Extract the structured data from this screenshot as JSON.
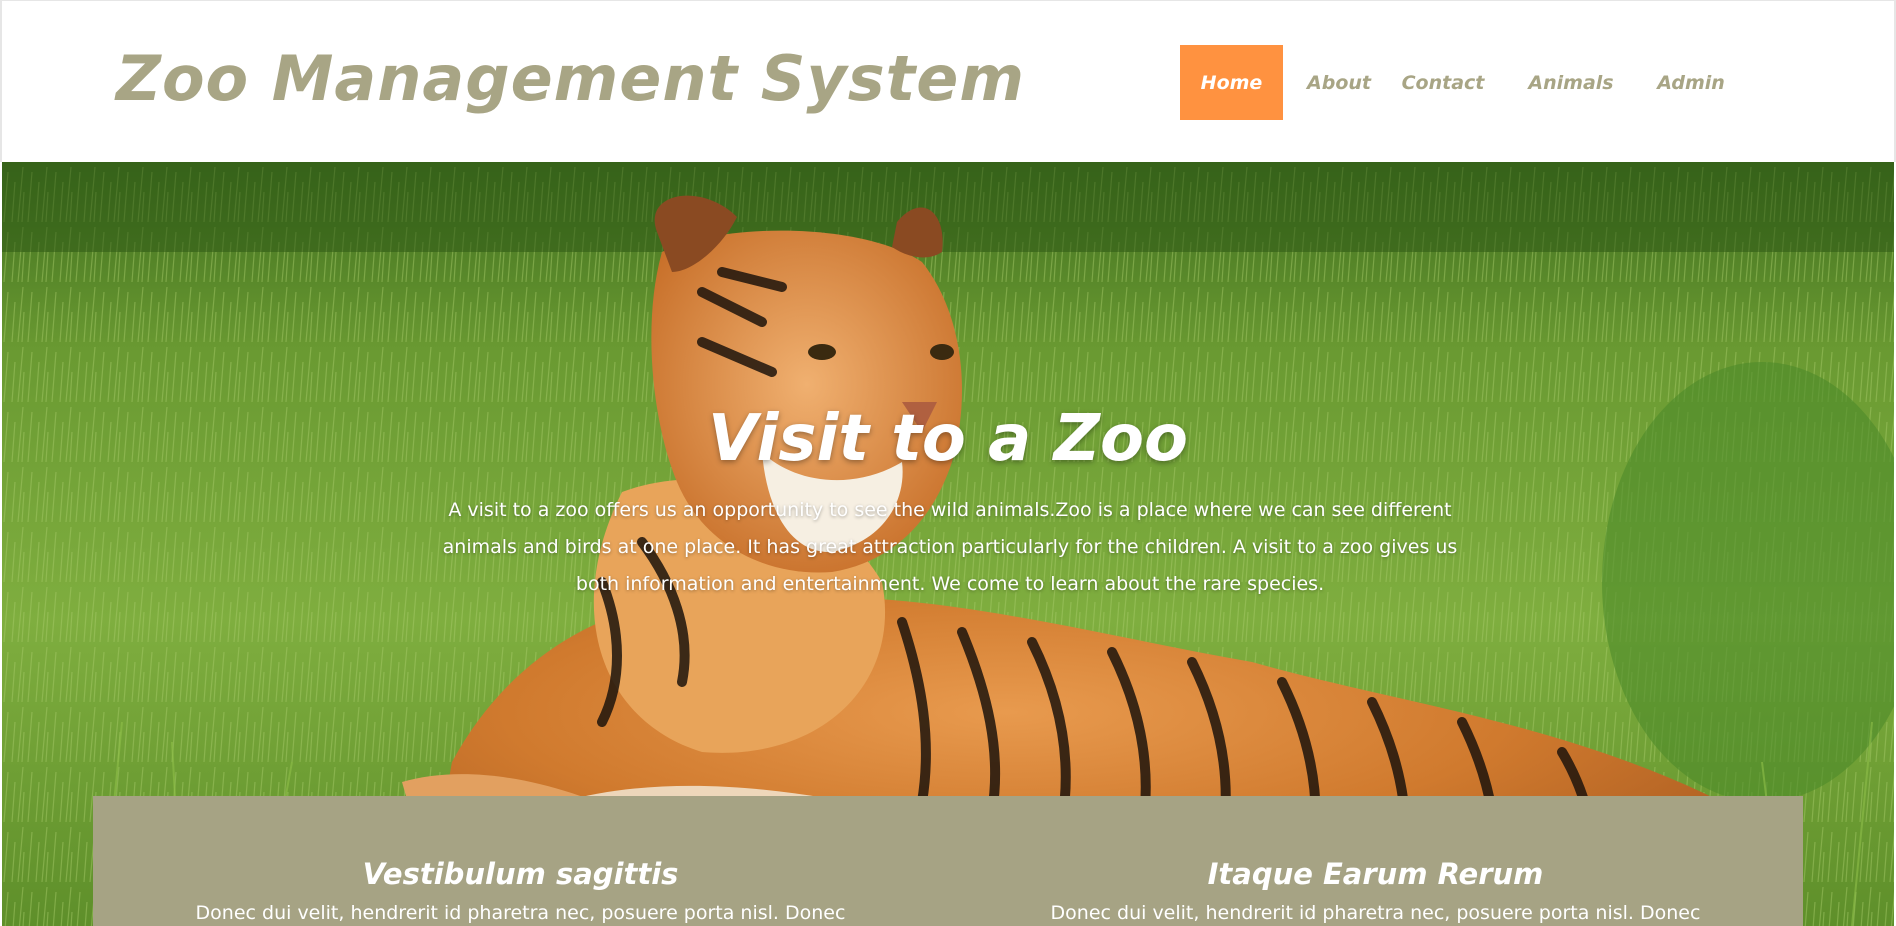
{
  "header": {
    "site_title": "Zoo Management System"
  },
  "nav": {
    "items": [
      {
        "label": "Home",
        "active": true
      },
      {
        "label": "About",
        "active": false
      },
      {
        "label": "Contact",
        "active": false
      },
      {
        "label": "Animals",
        "active": false
      },
      {
        "label": "Admin",
        "active": false
      }
    ]
  },
  "hero": {
    "heading": "Visit to a Zoo",
    "text": "A visit to a zoo offers us an opportunity to see the wild animals.Zoo is a place where we can see different animals and birds at one place. It has great attraction particularly for the children. A visit to a zoo gives us both information and entertainment. We come to learn about the rare species.",
    "image": "tiger-lying-in-grass"
  },
  "features": [
    {
      "title": "Vestibulum sagittis",
      "text": "Donec dui velit, hendrerit id pharetra nec, posuere porta nisl. Donec"
    },
    {
      "title": "Itaque Earum Rerum",
      "text": "Donec dui velit, hendrerit id pharetra nec, posuere porta nisl. Donec"
    }
  ],
  "colors": {
    "brand_olive": "#a8a585",
    "accent_orange": "#ff9240",
    "panel_olive": "#a6a384",
    "text_white": "#ffffff"
  }
}
